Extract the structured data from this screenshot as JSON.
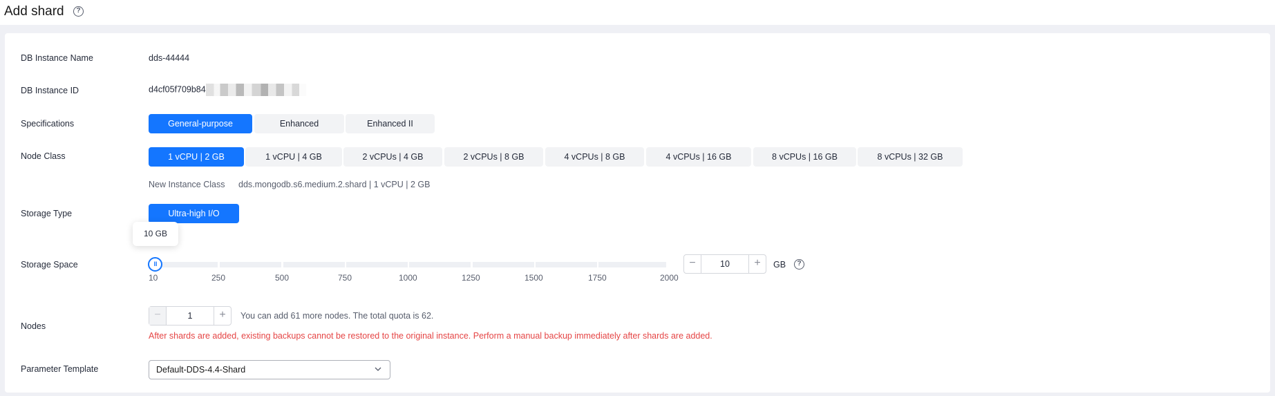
{
  "header": {
    "title": "Add shard"
  },
  "form": {
    "instance_name": {
      "label": "DB Instance Name",
      "value": "dds-44444"
    },
    "instance_id": {
      "label": "DB Instance ID",
      "value": "d4cf05f709b84"
    },
    "specifications": {
      "label": "Specifications",
      "options": [
        "General-purpose",
        "Enhanced",
        "Enhanced II"
      ],
      "selected": 0
    },
    "node_class": {
      "label": "Node Class",
      "options": [
        "1 vCPU | 2 GB",
        "1 vCPU | 4 GB",
        "2 vCPUs | 4 GB",
        "2 vCPUs | 8 GB",
        "4 vCPUs | 8 GB",
        "4 vCPUs | 16 GB",
        "8 vCPUs | 16 GB",
        "8 vCPUs | 32 GB"
      ],
      "selected": 0,
      "new_class_label": "New Instance Class",
      "new_class_value": "dds.mongodb.s6.medium.2.shard | 1 vCPU | 2 GB"
    },
    "storage_type": {
      "label": "Storage Type",
      "option": "Ultra-high I/O"
    },
    "storage_space": {
      "label": "Storage Space",
      "tooltip": "10 GB",
      "ticks": [
        "10",
        "250",
        "500",
        "750",
        "1000",
        "1250",
        "1500",
        "1750",
        "2000"
      ],
      "value": "10",
      "min": 10,
      "max": 2000,
      "unit": "GB"
    },
    "nodes": {
      "label": "Nodes",
      "value": "1",
      "hint": "You can add 61 more nodes. The total quota is 62.",
      "warning": "After shards are added, existing backups cannot be restored to the original instance. Perform a manual backup immediately after shards are added."
    },
    "parameter_template": {
      "label": "Parameter Template",
      "value": "Default-DDS-4.4-Shard"
    }
  },
  "colors": {
    "primary": "#1476ff",
    "warning": "#e54545"
  }
}
